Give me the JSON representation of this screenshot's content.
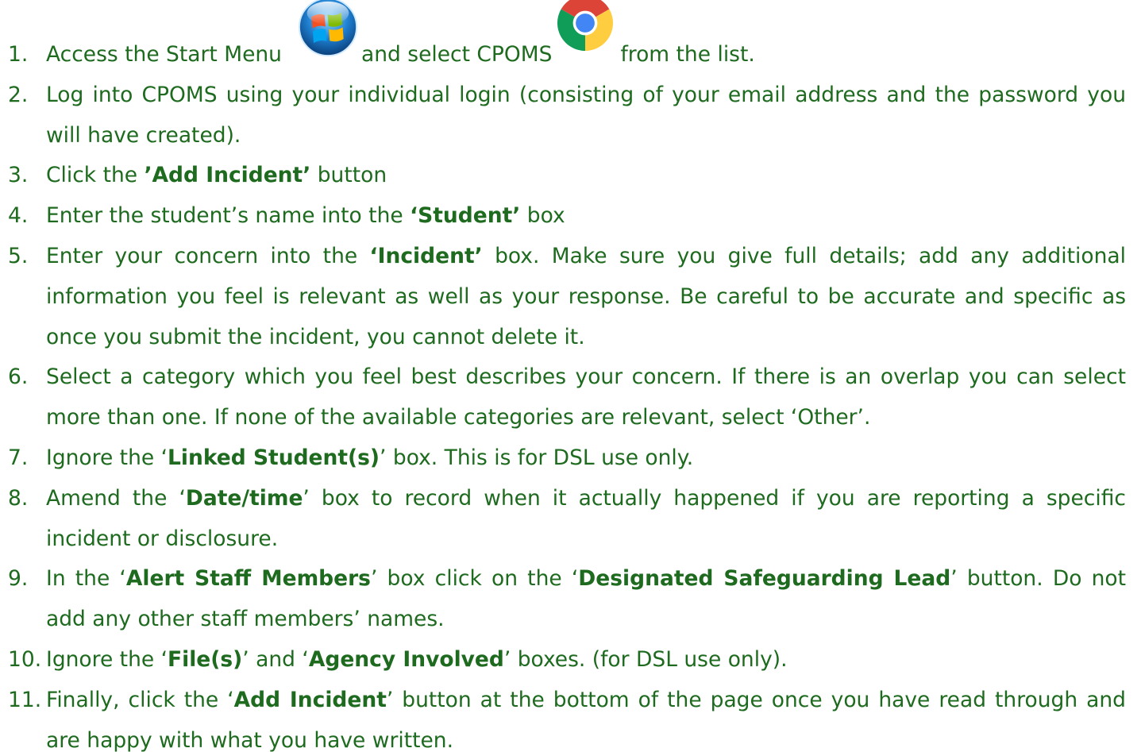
{
  "icons": {
    "start_menu": "windows-start-orb-icon",
    "cpoms": "chrome-browser-icon"
  },
  "colors": {
    "text": "#1e6b1f"
  },
  "steps": [
    {
      "number": "1.",
      "parts": [
        "Access the Start Menu",
        "and select CPOMS",
        "from the list."
      ]
    },
    {
      "number": "2.",
      "text": "Log into CPOMS using your individual login (consisting of your email address and the password you will have created)."
    },
    {
      "number": "3.",
      "before": "Click the ",
      "bold": "’Add Incident’",
      "after": " button"
    },
    {
      "number": "4.",
      "before": "Enter the student’s name into the ",
      "bold": "‘Student’",
      "after": " box"
    },
    {
      "number": "5.",
      "before": "Enter your concern into the ",
      "bold": "‘Incident’",
      "after": " box. Make sure you give full details; add any additional information you feel is relevant as well as your response. Be careful to be accurate and specific as once you submit the incident, you cannot delete it."
    },
    {
      "number": "6.",
      "text": "Select a category which you feel best describes your concern. If there is an overlap you can select more than one. If none of the available categories are relevant, select ‘Other’."
    },
    {
      "number": "7.",
      "before": "Ignore the ‘",
      "bold": "Linked Student(s)",
      "after": "’ box. This is for DSL use only."
    },
    {
      "number": "8.",
      "before": "Amend the ‘",
      "bold": "Date/time",
      "after": "’ box to record when it actually happened if you are reporting a specific incident or disclosure."
    },
    {
      "number": "9.",
      "before": "In the ‘",
      "bold": "Alert Staff Members",
      "middle": "’ box click on the ‘",
      "bold2": "Designated Safeguarding Lead",
      "after": "’ button. Do not add any other staff members’ names."
    },
    {
      "number": "10.",
      "before": "Ignore the ‘",
      "bold": "File(s)",
      "middle": "’ and ‘",
      "bold2": "Agency Involved",
      "after": "’ boxes. (for DSL use only)."
    },
    {
      "number": "11.",
      "before": "Finally, click the ‘",
      "bold": "Add Incident",
      "after": "’ button at the bottom of the page once you have read through and are happy with what you have written."
    }
  ]
}
